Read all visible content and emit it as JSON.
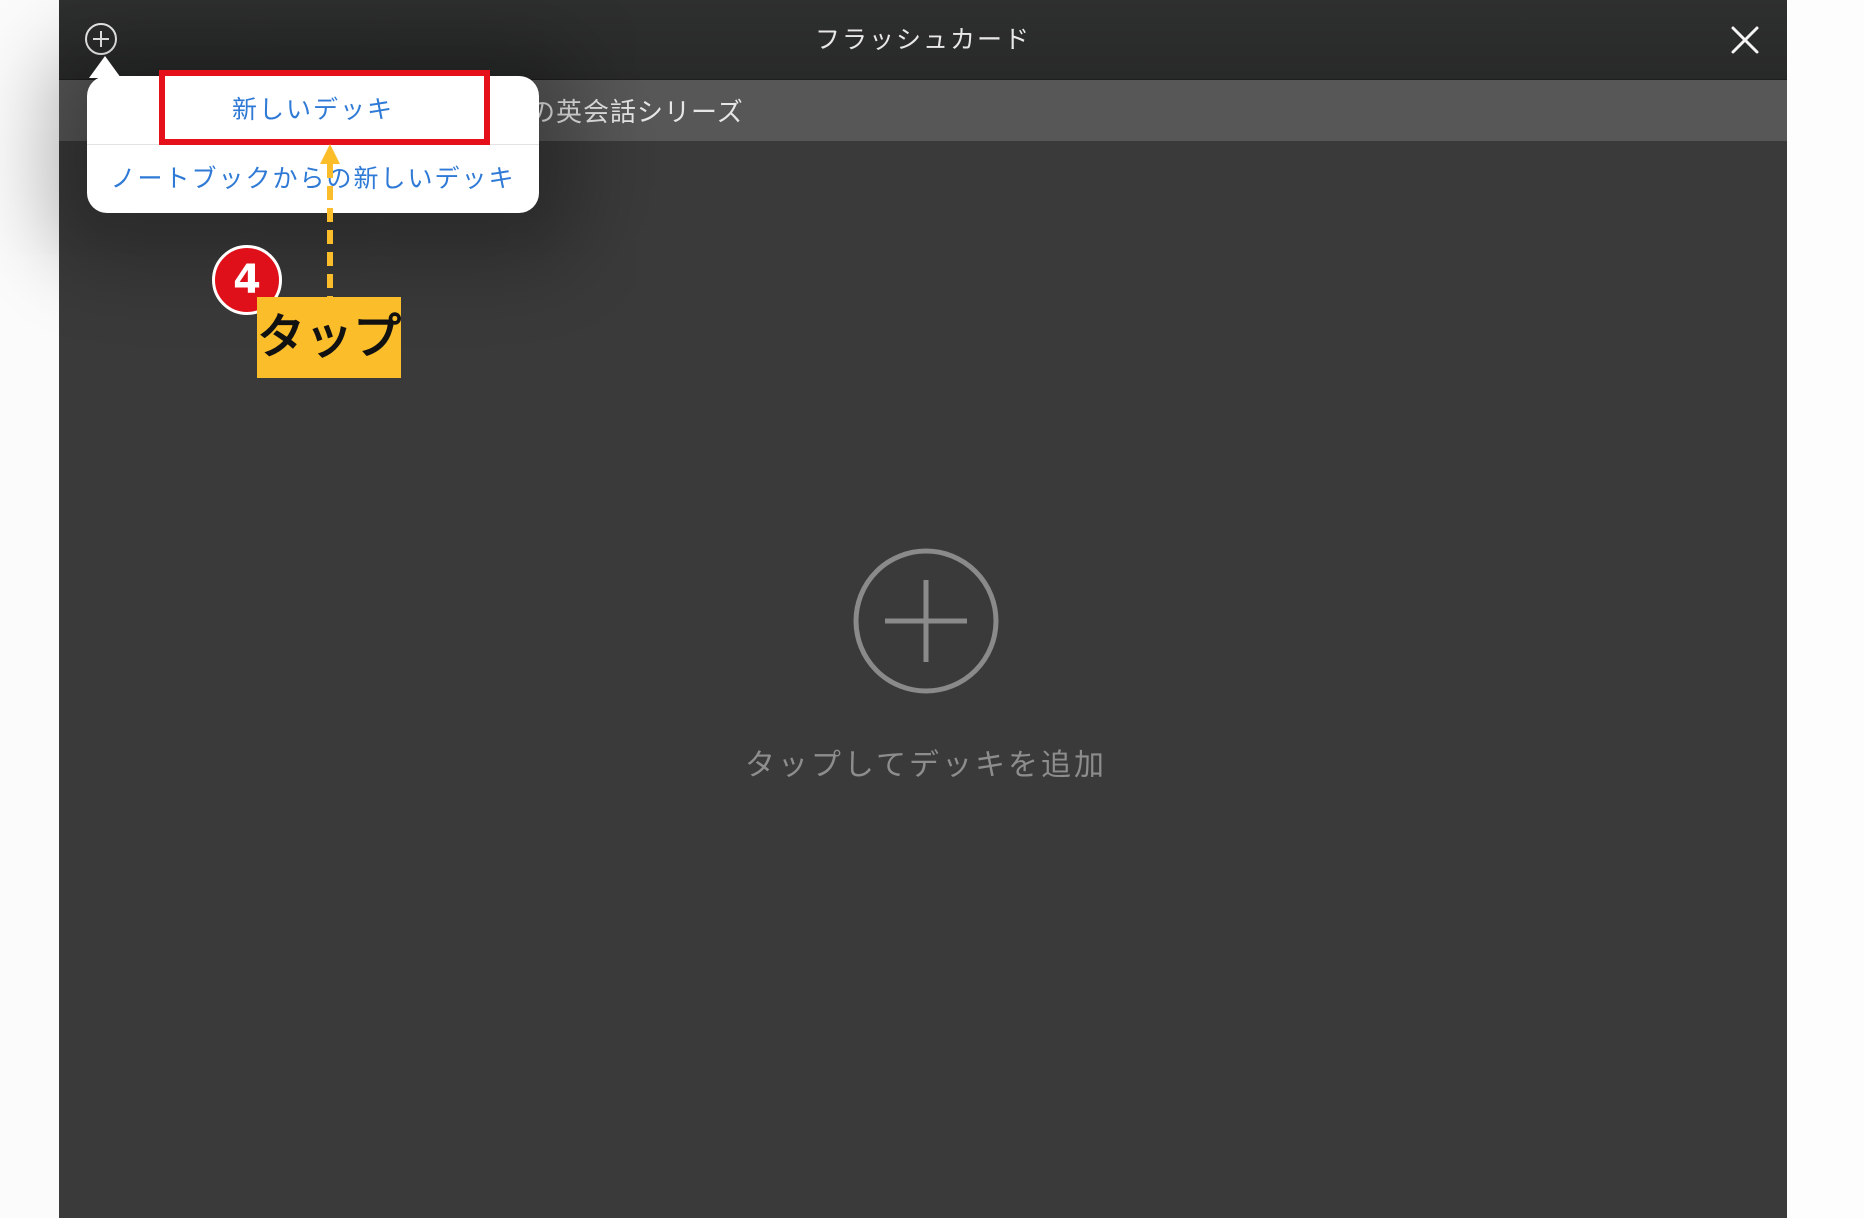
{
  "navbar": {
    "title": "フラッシュカード",
    "add_icon": "plus-circle-icon",
    "close_icon": "close-icon"
  },
  "tabbar": {
    "label": "の英会話シリーズ"
  },
  "popover": {
    "items": [
      {
        "label": "新しいデッキ"
      },
      {
        "label": "ノートブックからの新しいデッキ"
      }
    ]
  },
  "empty_state": {
    "icon": "plus-circle-icon",
    "text": "タップしてデッキを追加"
  },
  "annotation": {
    "step_number": "4",
    "tap_label": "タップ",
    "highlight_color": "#e6101a",
    "label_color": "#fbbd2a",
    "arrow_color": "#fbbd2a"
  },
  "colors": {
    "background": "#3a3a3a",
    "navbar": "#2b2c2c",
    "tabbar": "#575757",
    "menu_text": "#2f7ad6"
  }
}
